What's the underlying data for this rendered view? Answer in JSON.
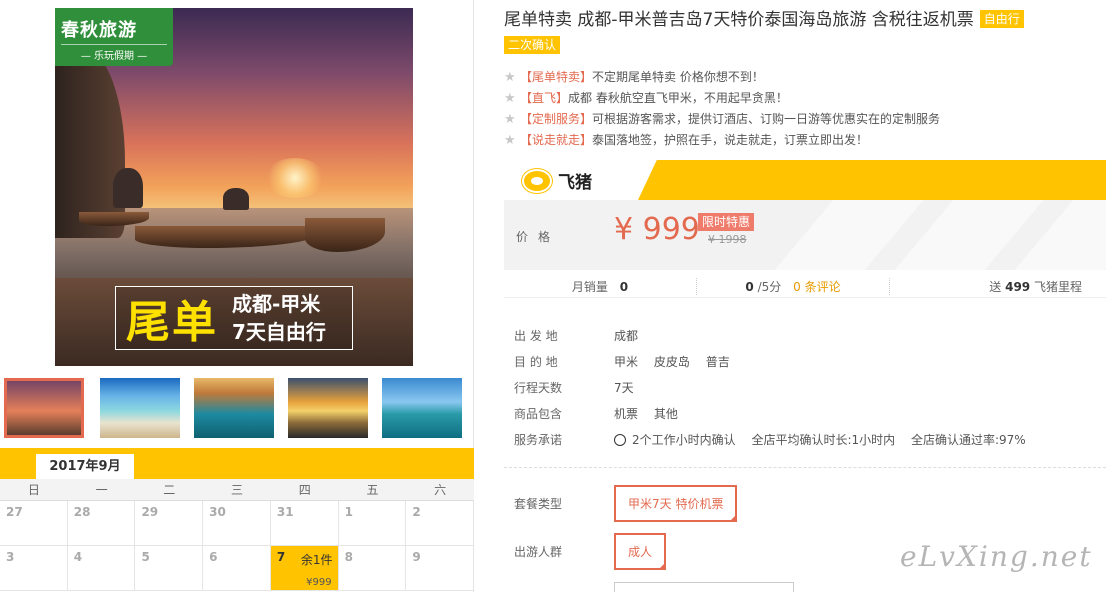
{
  "gallery": {
    "logo_text": "春秋旅游",
    "logo_sub": "— 乐玩假期 —",
    "overlay_big": "尾单",
    "overlay_line1": "成都-甲米",
    "overlay_line2": "7天自由行"
  },
  "calendar": {
    "month": "2017年9月",
    "weekdays": [
      "日",
      "一",
      "二",
      "三",
      "四",
      "五",
      "六"
    ],
    "rows": [
      [
        "27",
        "28",
        "29",
        "30",
        "31",
        "1",
        "2"
      ],
      [
        "3",
        "4",
        "5",
        "6",
        "7",
        "8",
        "9"
      ]
    ],
    "selected": {
      "day": "7",
      "stock": "余1件",
      "price": "¥999"
    }
  },
  "product": {
    "title": "尾单特卖 成都-甲米普吉岛7天特价泰国海岛旅游 含税往返机票",
    "tag1": "自由行",
    "tag2": "二次确认",
    "features": [
      {
        "bracket": "【尾单特卖】",
        "text": "不定期尾单特卖 价格你想不到！"
      },
      {
        "bracket": "【直飞】",
        "text": "成都 春秋航空直飞甲米，不用起早贪黑！"
      },
      {
        "bracket": "【定制服务】",
        "text": "可根据游客需求，提供订酒店、订购一日游等优惠实在的定制服务"
      },
      {
        "bracket": "【说走就走】",
        "text": "泰国落地签，护照在手，说走就走，订票立即出发！"
      }
    ]
  },
  "price": {
    "brand": "飞猪",
    "label": "价格",
    "amount": "¥ 999",
    "promo": "限时特惠",
    "original": "¥ 1998"
  },
  "stats": {
    "monthly_label": "月销量",
    "monthly_value": "0",
    "score_value": "0",
    "score_unit": "/5分",
    "reviews": "0 条评论",
    "miles_prefix": "送",
    "miles_value": "499",
    "miles_suffix": "飞猪里程"
  },
  "info": {
    "depart_label": "出 发 地",
    "depart_value": "成都",
    "dest_label": "目 的 地",
    "dest_values": [
      "甲米",
      "皮皮岛",
      "普吉"
    ],
    "days_label": "行程天数",
    "days_value": "7天",
    "includes_label": "商品包含",
    "includes_values": [
      "机票",
      "其他"
    ],
    "promise_label": "服务承诺",
    "promise_values": [
      "2个工作小时内确认",
      "全店平均确认时长:1小时内",
      "全店确认通过率:97%"
    ]
  },
  "options": {
    "package_label": "套餐类型",
    "package_value": "甲米7天 特价机票",
    "crowd_label": "出游人群",
    "crowd_value": "成人"
  },
  "watermark": "eLvXing.net"
}
